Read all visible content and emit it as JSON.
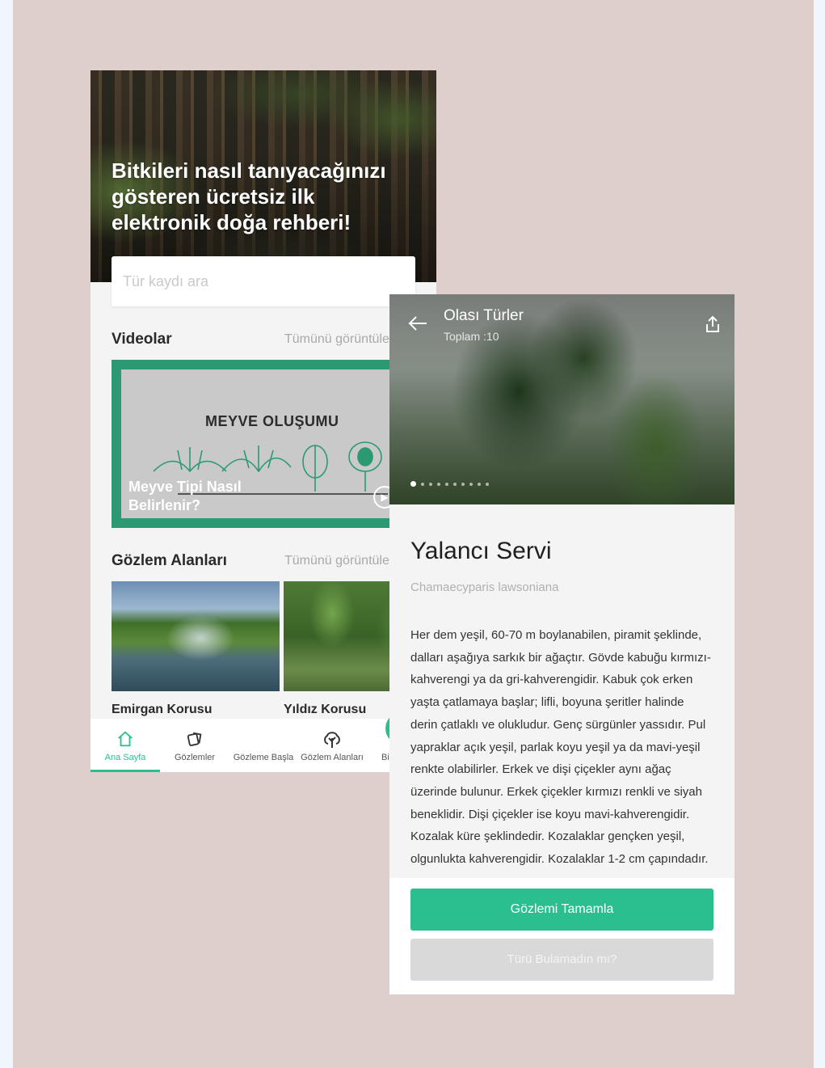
{
  "home": {
    "hero_title": "Bitkileri nasıl tanıyacağınızı gösteren ücretsiz ilk elektronik doğa rehberi!",
    "search_placeholder": "Tür kaydı ara",
    "videos": {
      "title": "Videolar",
      "see_all": "Tümünü görüntüle",
      "card_heading": "MEYVE OLUŞUMU",
      "card_caption": "Meyve Tipi Nasıl Belirlenir?"
    },
    "areas": {
      "title": "Gözlem Alanları",
      "see_all": "Tümünü görüntüle",
      "items": [
        {
          "name": "Emirgan Korusu"
        },
        {
          "name": "Yıldız Korusu"
        }
      ]
    },
    "tabs": [
      {
        "label": "Ana Sayfa",
        "icon": "home-icon",
        "active": true
      },
      {
        "label": "Gözlemler",
        "icon": "cards-icon",
        "active": false
      },
      {
        "label": "Gözleme Başla",
        "icon": "plus-icon",
        "active": false
      },
      {
        "label": "Gözlem Alanları",
        "icon": "tree-icon",
        "active": false
      },
      {
        "label": "Bi",
        "icon": "",
        "active": false
      }
    ]
  },
  "detail": {
    "header_title": "Olası Türler",
    "header_subtitle": "Toplam :10",
    "carousel_count": 10,
    "carousel_active": 0,
    "species_name": "Yalancı Servi",
    "species_latin": "Chamaecyparis lawsoniana",
    "description": "Her dem yeşil, 60-70 m boylanabilen, piramit şeklinde, dalları aşağıya sarkık bir ağaçtır. Gövde kabuğu kırmızı-kahverengi ya da gri-kahverengidir. Kabuk çok erken yaşta çatlamaya başlar; lifli, boyuna şeritler halinde derin çatlaklı ve olukludur. Genç sürgünler yassıdır. Pul yapraklar açık yeşil, parlak koyu yeşil ya da mavi-yeşil renkte olabilirler. Erkek ve dişi çiçekler aynı ağaç üzerinde bulunur. Erkek çiçekler kırmızı renkli ve siyah beneklidir. Dişi çiçekler ise koyu mavi-kahverengidir. Kozalak küre şeklindedir. Kozalaklar gençken yeşil, olgunlukta kahverengidir. Kozalaklar 1-2 cm çapındadır.",
    "primary_button": "Gözlemi Tamamla",
    "secondary_button": "Türü Bulamadın mı?"
  },
  "colors": {
    "accent": "#2bbf8f",
    "video_border": "#2b9a72",
    "background": "#dfcfcc"
  }
}
